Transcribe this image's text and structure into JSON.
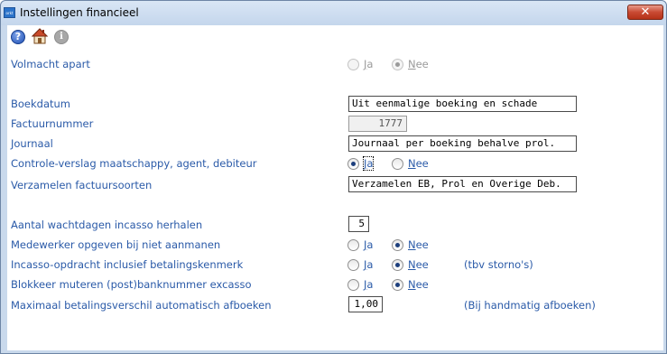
{
  "window": {
    "title": "Instellingen financieel",
    "close_glyph": "✕",
    "app_icon_text": "orkt"
  },
  "toolbar": {
    "help_glyph": "?",
    "info_glyph": "i"
  },
  "yes_label_u": "J",
  "yes_label_rest": "a",
  "no_label_u": "N",
  "no_label_rest": "ee",
  "rows": {
    "volmacht": {
      "label": "Volmacht apart"
    },
    "boekdatum": {
      "label": "Boekdatum",
      "value": "Uit eenmalige boeking en schade"
    },
    "factuurnummer": {
      "label": "Factuurnummer",
      "value": "1777"
    },
    "journaal": {
      "label": "Journaal",
      "value": "Journaal per boeking behalve prol."
    },
    "controle": {
      "label": "Controle-verslag maatschappy, agent, debiteur"
    },
    "verzamelen": {
      "label": "Verzamelen factuursoorten",
      "value": "Verzamelen EB, Prol en Overige Deb."
    },
    "wachtdagen": {
      "label": "Aantal wachtdagen incasso herhalen",
      "value": "5"
    },
    "medewerker": {
      "label": "Medewerker opgeven bij niet aanmanen"
    },
    "incasso": {
      "label": "Incasso-opdracht inclusief betalingskenmerk",
      "note": "(tbv storno's)"
    },
    "blokkeer": {
      "label": "Blokkeer muteren (post)banknummer excasso"
    },
    "maximaal": {
      "label": "Maximaal betalingsverschil automatisch afboeken",
      "value": "1,00",
      "note": "(Bij handmatig afboeken)"
    }
  }
}
